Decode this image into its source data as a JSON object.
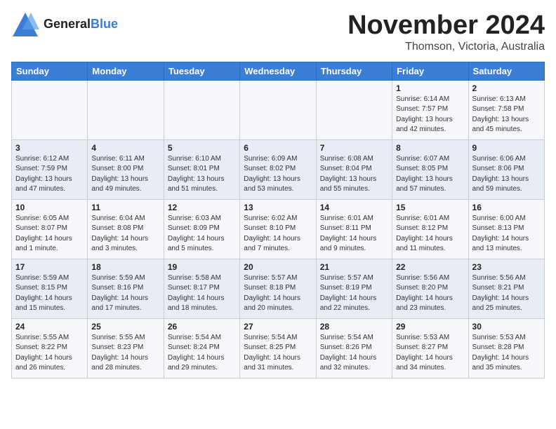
{
  "header": {
    "logo_line1": "General",
    "logo_line2": "Blue",
    "month": "November 2024",
    "location": "Thomson, Victoria, Australia"
  },
  "days_of_week": [
    "Sunday",
    "Monday",
    "Tuesday",
    "Wednesday",
    "Thursday",
    "Friday",
    "Saturday"
  ],
  "weeks": [
    [
      {
        "day": "",
        "info": ""
      },
      {
        "day": "",
        "info": ""
      },
      {
        "day": "",
        "info": ""
      },
      {
        "day": "",
        "info": ""
      },
      {
        "day": "",
        "info": ""
      },
      {
        "day": "1",
        "info": "Sunrise: 6:14 AM\nSunset: 7:57 PM\nDaylight: 13 hours\nand 42 minutes."
      },
      {
        "day": "2",
        "info": "Sunrise: 6:13 AM\nSunset: 7:58 PM\nDaylight: 13 hours\nand 45 minutes."
      }
    ],
    [
      {
        "day": "3",
        "info": "Sunrise: 6:12 AM\nSunset: 7:59 PM\nDaylight: 13 hours\nand 47 minutes."
      },
      {
        "day": "4",
        "info": "Sunrise: 6:11 AM\nSunset: 8:00 PM\nDaylight: 13 hours\nand 49 minutes."
      },
      {
        "day": "5",
        "info": "Sunrise: 6:10 AM\nSunset: 8:01 PM\nDaylight: 13 hours\nand 51 minutes."
      },
      {
        "day": "6",
        "info": "Sunrise: 6:09 AM\nSunset: 8:02 PM\nDaylight: 13 hours\nand 53 minutes."
      },
      {
        "day": "7",
        "info": "Sunrise: 6:08 AM\nSunset: 8:04 PM\nDaylight: 13 hours\nand 55 minutes."
      },
      {
        "day": "8",
        "info": "Sunrise: 6:07 AM\nSunset: 8:05 PM\nDaylight: 13 hours\nand 57 minutes."
      },
      {
        "day": "9",
        "info": "Sunrise: 6:06 AM\nSunset: 8:06 PM\nDaylight: 13 hours\nand 59 minutes."
      }
    ],
    [
      {
        "day": "10",
        "info": "Sunrise: 6:05 AM\nSunset: 8:07 PM\nDaylight: 14 hours\nand 1 minute."
      },
      {
        "day": "11",
        "info": "Sunrise: 6:04 AM\nSunset: 8:08 PM\nDaylight: 14 hours\nand 3 minutes."
      },
      {
        "day": "12",
        "info": "Sunrise: 6:03 AM\nSunset: 8:09 PM\nDaylight: 14 hours\nand 5 minutes."
      },
      {
        "day": "13",
        "info": "Sunrise: 6:02 AM\nSunset: 8:10 PM\nDaylight: 14 hours\nand 7 minutes."
      },
      {
        "day": "14",
        "info": "Sunrise: 6:01 AM\nSunset: 8:11 PM\nDaylight: 14 hours\nand 9 minutes."
      },
      {
        "day": "15",
        "info": "Sunrise: 6:01 AM\nSunset: 8:12 PM\nDaylight: 14 hours\nand 11 minutes."
      },
      {
        "day": "16",
        "info": "Sunrise: 6:00 AM\nSunset: 8:13 PM\nDaylight: 14 hours\nand 13 minutes."
      }
    ],
    [
      {
        "day": "17",
        "info": "Sunrise: 5:59 AM\nSunset: 8:15 PM\nDaylight: 14 hours\nand 15 minutes."
      },
      {
        "day": "18",
        "info": "Sunrise: 5:59 AM\nSunset: 8:16 PM\nDaylight: 14 hours\nand 17 minutes."
      },
      {
        "day": "19",
        "info": "Sunrise: 5:58 AM\nSunset: 8:17 PM\nDaylight: 14 hours\nand 18 minutes."
      },
      {
        "day": "20",
        "info": "Sunrise: 5:57 AM\nSunset: 8:18 PM\nDaylight: 14 hours\nand 20 minutes."
      },
      {
        "day": "21",
        "info": "Sunrise: 5:57 AM\nSunset: 8:19 PM\nDaylight: 14 hours\nand 22 minutes."
      },
      {
        "day": "22",
        "info": "Sunrise: 5:56 AM\nSunset: 8:20 PM\nDaylight: 14 hours\nand 23 minutes."
      },
      {
        "day": "23",
        "info": "Sunrise: 5:56 AM\nSunset: 8:21 PM\nDaylight: 14 hours\nand 25 minutes."
      }
    ],
    [
      {
        "day": "24",
        "info": "Sunrise: 5:55 AM\nSunset: 8:22 PM\nDaylight: 14 hours\nand 26 minutes."
      },
      {
        "day": "25",
        "info": "Sunrise: 5:55 AM\nSunset: 8:23 PM\nDaylight: 14 hours\nand 28 minutes."
      },
      {
        "day": "26",
        "info": "Sunrise: 5:54 AM\nSunset: 8:24 PM\nDaylight: 14 hours\nand 29 minutes."
      },
      {
        "day": "27",
        "info": "Sunrise: 5:54 AM\nSunset: 8:25 PM\nDaylight: 14 hours\nand 31 minutes."
      },
      {
        "day": "28",
        "info": "Sunrise: 5:54 AM\nSunset: 8:26 PM\nDaylight: 14 hours\nand 32 minutes."
      },
      {
        "day": "29",
        "info": "Sunrise: 5:53 AM\nSunset: 8:27 PM\nDaylight: 14 hours\nand 34 minutes."
      },
      {
        "day": "30",
        "info": "Sunrise: 5:53 AM\nSunset: 8:28 PM\nDaylight: 14 hours\nand 35 minutes."
      }
    ]
  ]
}
